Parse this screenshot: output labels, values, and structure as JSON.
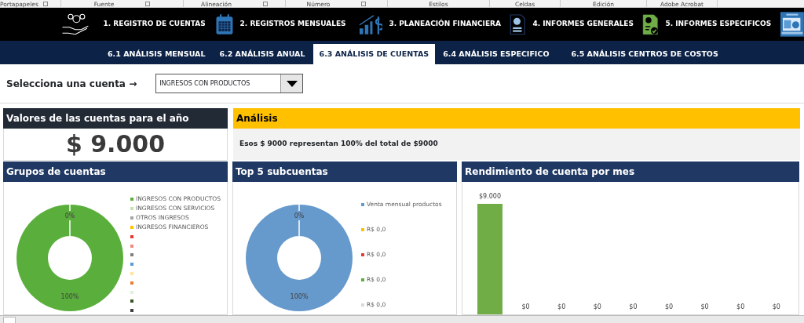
{
  "ribbon_groups": [
    {
      "label": "Portapapeles",
      "launcher": true
    },
    {
      "label": "Fuente",
      "launcher": true
    },
    {
      "label": "Alineación",
      "launcher": true
    },
    {
      "label": "Número",
      "launcher": true
    },
    {
      "label": "Estilos",
      "launcher": false
    },
    {
      "label": "Celdas",
      "launcher": false
    },
    {
      "label": "Edición",
      "launcher": false
    },
    {
      "label": "Adobe Acrobat",
      "launcher": false
    }
  ],
  "nav": [
    {
      "label": "1. REGISTRO DE CUENTAS"
    },
    {
      "label": "2. REGISTROS MENSUALES"
    },
    {
      "label": "3. PLANEACIÓN FINANCIERA"
    },
    {
      "label": "4. INFORMES GENERALES"
    },
    {
      "label": "5. INFORMES ESPECIFICOS"
    }
  ],
  "tabs": [
    {
      "label": "6.1 ANÁLISIS MENSUAL",
      "selected": false
    },
    {
      "label": "6.2 ANÁLISIS ANUAL",
      "selected": false
    },
    {
      "label": "6.3 ANÁLISIS DE CUENTAS",
      "selected": true
    },
    {
      "label": "6.4 ANÁLISIS ESPECIFICO",
      "selected": false
    },
    {
      "label": "6.5 ANÁLISIS CENTROS DE COSTOS",
      "selected": false
    }
  ],
  "account_selector": {
    "label": "Selecciona una cuenta →",
    "value": "INGRESOS CON PRODUCTOS"
  },
  "annual_value": {
    "title": "Valores de las cuentas para el año",
    "value": "$ 9.000"
  },
  "analysis": {
    "title": "Análisis",
    "text": "Esos $ 9000 representan 100% del total de $9000"
  },
  "groups_chart": {
    "title": "Grupos de cuentas",
    "legend": [
      {
        "label": "INGRESOS CON PRODUCTOS",
        "color": "#5aaf3c"
      },
      {
        "label": "INGRESOS CON SERVICIOS",
        "color": "#c6e0b4"
      },
      {
        "label": "OTROS INGRESOS",
        "color": "#a5a5a5"
      },
      {
        "label": "INGRESOS FINANCIEROS",
        "color": "#ffc000"
      },
      {
        "color": "#e53935"
      },
      {
        "color": "#f4877f"
      },
      {
        "color": "#7f7f7f"
      },
      {
        "color": "#5b9bd5"
      },
      {
        "color": "#ffe699"
      },
      {
        "color": "#ed7d31"
      },
      {
        "color": "#e2efda"
      },
      {
        "color": "#375623"
      },
      {
        "color": "#404040"
      }
    ],
    "ring_labels": [
      "0%",
      "100%"
    ]
  },
  "top5_chart": {
    "title": "Top 5 subcuentas",
    "legend": [
      {
        "label": "Venta mensual productos",
        "color": "#6699cc"
      },
      {
        "label": "R$ 0,0",
        "color": "#ffc000"
      },
      {
        "label": "R$ 0,0",
        "color": "#e53935"
      },
      {
        "label": "R$ 0,0",
        "color": "#5aaf3c"
      },
      {
        "label": "R$ 0,0",
        "color": "#d9d9d9"
      }
    ],
    "ring_labels": [
      "0%",
      "100%"
    ]
  },
  "monthly_chart": {
    "title": "Rendimiento de cuenta por mes",
    "columns": [
      {
        "label": "$9.000",
        "bar": true
      },
      {
        "label": "$0",
        "bar": false
      },
      {
        "label": "$0",
        "bar": false
      },
      {
        "label": "$0",
        "bar": false
      },
      {
        "label": "$0",
        "bar": false
      },
      {
        "label": "$0",
        "bar": false
      },
      {
        "label": "$0",
        "bar": false
      },
      {
        "label": "$0",
        "bar": false
      },
      {
        "label": "$0",
        "bar": false
      }
    ]
  }
}
